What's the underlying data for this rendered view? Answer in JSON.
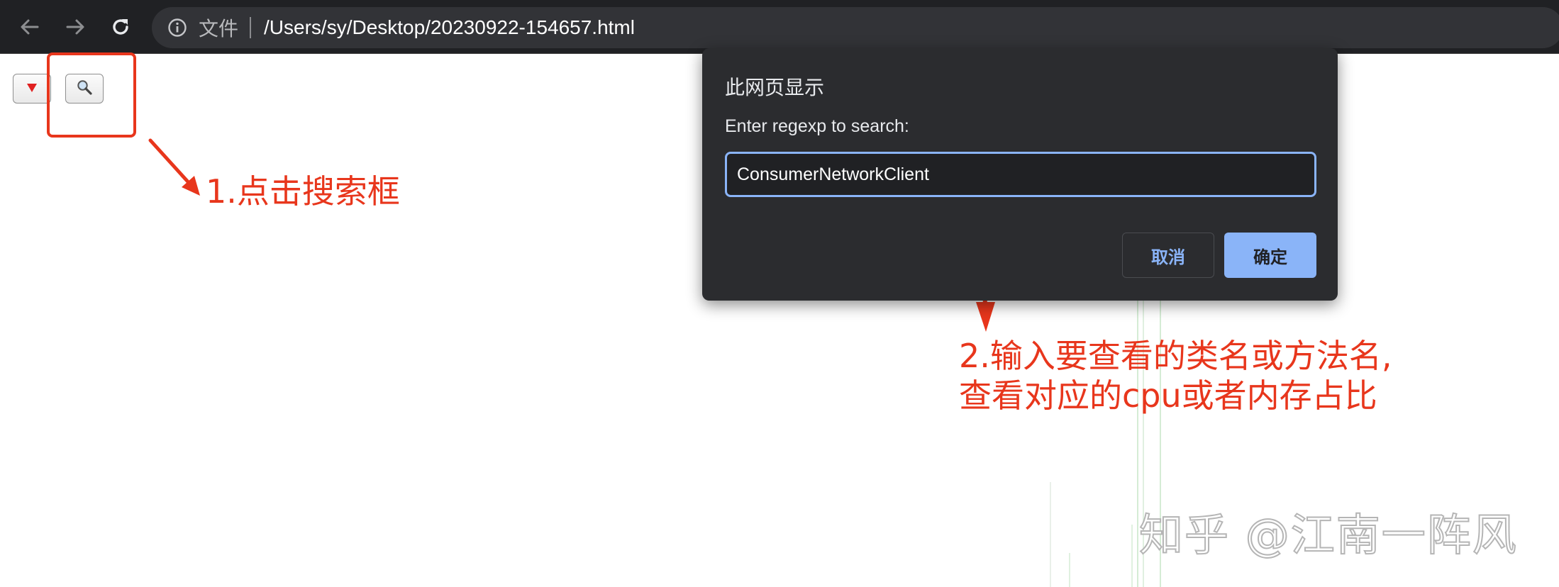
{
  "browser": {
    "scheme_label": "文件",
    "url": "/Users/sy/Desktop/20230922-154657.html",
    "icons": {
      "back": "arrow-left-icon",
      "forward": "arrow-right-icon",
      "reload": "reload-icon",
      "site_info": "info-icon"
    }
  },
  "page": {
    "toggle_icon": "triangle-down-icon",
    "search_icon": "magnifier-icon"
  },
  "annotations": {
    "step1": "1.点击搜索框",
    "step2_line1": "2.输入要查看的类名或方法名,",
    "step2_line2": "查看对应的cpu或者内存占比",
    "color": "#e8361c"
  },
  "dialog": {
    "title": "此网页显示",
    "message": "Enter regexp to search:",
    "input_value": "ConsumerNetworkClient",
    "cancel_label": "取消",
    "ok_label": "确定"
  },
  "watermark": {
    "text": "知乎 @江南一阵风"
  }
}
